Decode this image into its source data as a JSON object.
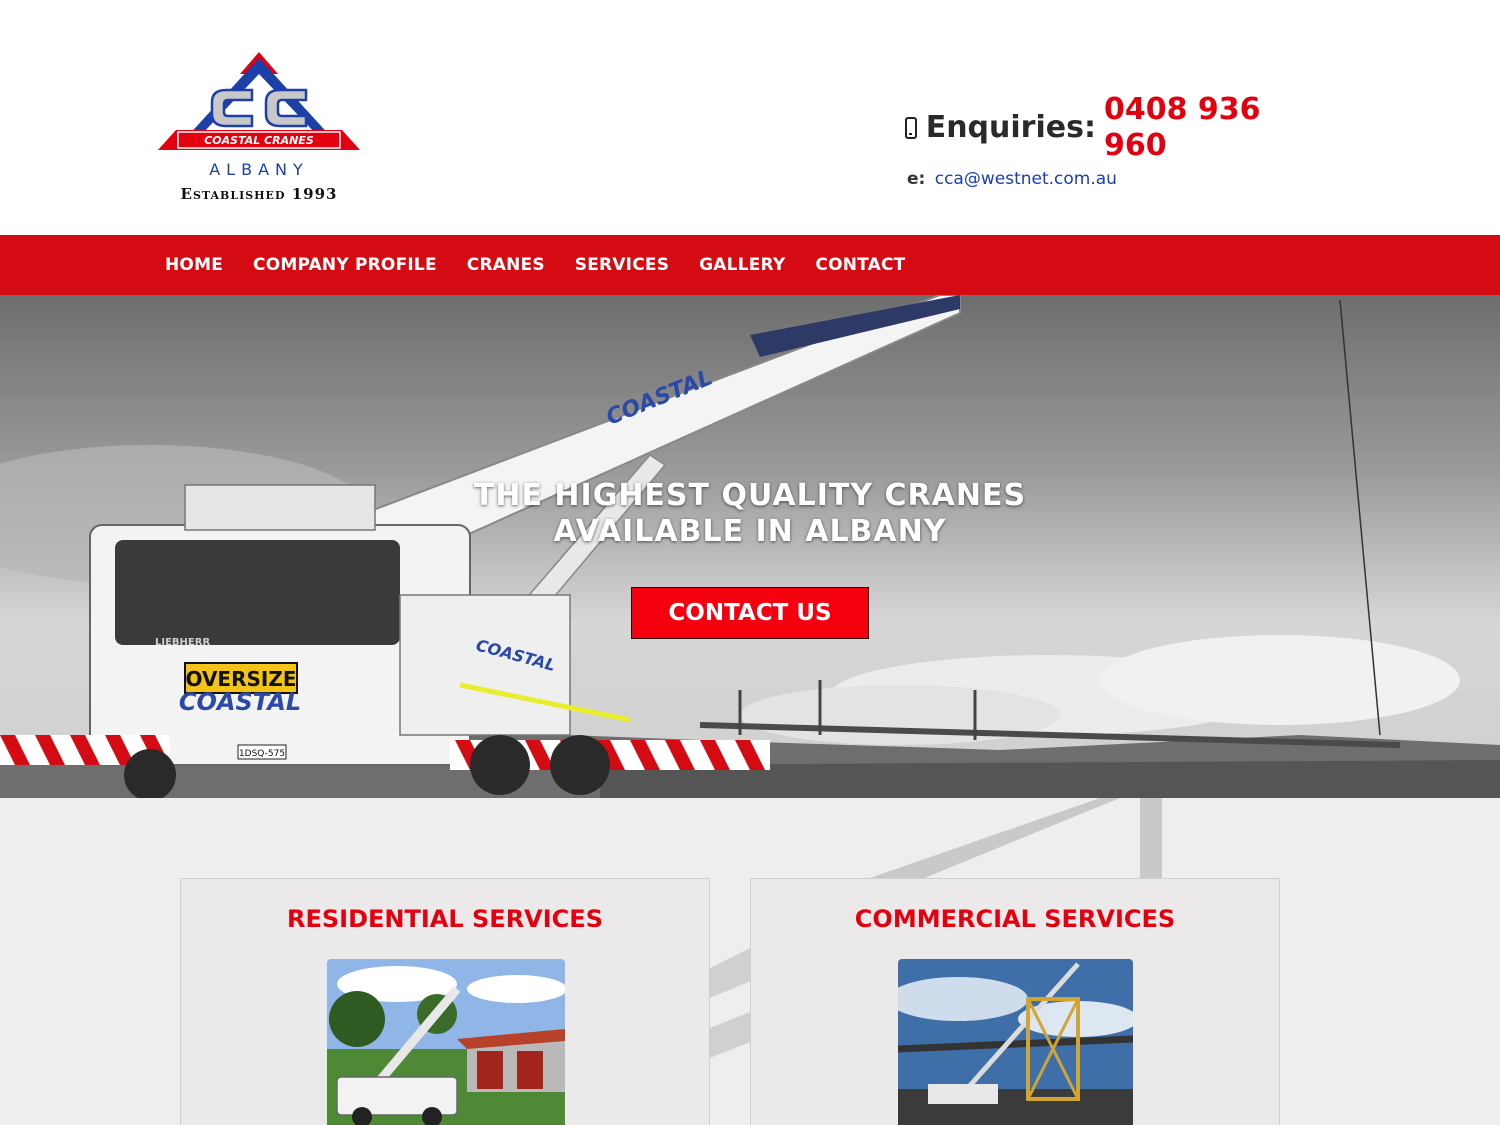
{
  "header": {
    "logo": {
      "brand": "COASTAL CRANES",
      "location": "ALBANY",
      "established": "Established 1993",
      "monogram": "CC"
    },
    "enquiries_label": "Enquiries:",
    "phone": "0408 936 960",
    "email_label": "e:",
    "email": "cca@westnet.com.au",
    "phone_icon": "mobile-phone-icon"
  },
  "nav": {
    "items": [
      {
        "label": "HOME"
      },
      {
        "label": "COMPANY PROFILE"
      },
      {
        "label": "CRANES"
      },
      {
        "label": "SERVICES"
      },
      {
        "label": "GALLERY"
      },
      {
        "label": "CONTACT"
      }
    ]
  },
  "hero": {
    "title_line1": "THE HIGHEST QUALITY CRANES",
    "title_line2": "AVAILABLE IN ALBANY",
    "cta_label": "CONTACT US",
    "truck": {
      "boom_text": "COASTAL",
      "plate_text": "OVERSIZE",
      "front_text": "COASTAL",
      "make": "LIEBHERR",
      "rego": "1DSQ-575"
    }
  },
  "services": {
    "cards": [
      {
        "title": "RESIDENTIAL SERVICES"
      },
      {
        "title": "COMMERCIAL SERVICES"
      }
    ]
  },
  "colors": {
    "brand_red": "#d50b13",
    "accent_red": "#e3000f",
    "link_blue": "#1a3db0",
    "logo_blue": "#1d3fa8"
  }
}
